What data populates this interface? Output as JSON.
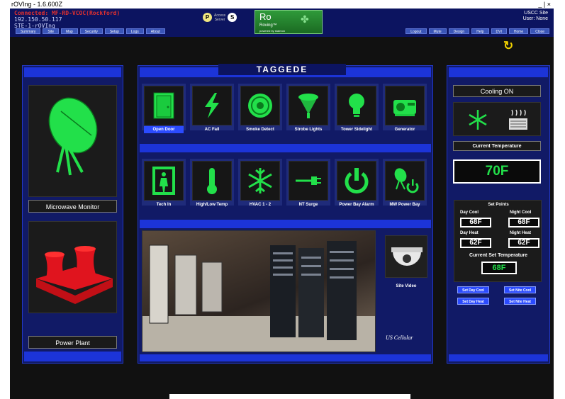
{
  "window": {
    "title": "rOVIng - 1.6.600Z",
    "controls": "_ | ×"
  },
  "connection": {
    "line1": "Connected: MF-RD-VCOC(Rockford)",
    "line2": "192.150.50.117",
    "line3": "STE-1-rOVIng"
  },
  "pserver": {
    "p": "P",
    "s": "S",
    "line1": "Access",
    "line2": "Server"
  },
  "logo": {
    "ro": "Ro",
    "roving": "Roving™",
    "powered": "powered by statmon"
  },
  "site_info": {
    "line1": "USCC Site",
    "line2": "User: None"
  },
  "nav_left": [
    "Summary",
    "Site",
    "Map",
    "Security",
    "Setup",
    "Logs",
    "About"
  ],
  "nav_right": [
    "Logout",
    "Mute",
    "Design",
    "Help",
    "DVI",
    "Home",
    "Close"
  ],
  "left": {
    "top_label": "Microwave Monitor",
    "bottom_label": "Power Plant"
  },
  "center": {
    "header": "TAGGEDE",
    "row1": [
      {
        "label": "Open Door",
        "icon": "door-icon",
        "active": true
      },
      {
        "label": "AC Fail",
        "icon": "lightning-icon",
        "active": false
      },
      {
        "label": "Smoke Detect",
        "icon": "smoke-detector-icon",
        "active": false
      },
      {
        "label": "Strobe Lights",
        "icon": "strobe-light-icon",
        "active": false
      },
      {
        "label": "Tower Sidelight",
        "icon": "bulb-icon",
        "active": false
      },
      {
        "label": "Generator",
        "icon": "generator-icon",
        "active": false
      }
    ],
    "row2": [
      {
        "label": "Tech In",
        "icon": "person-door-icon"
      },
      {
        "label": "High/Low Temp",
        "icon": "thermometer-icon"
      },
      {
        "label": "HVAC 1 - 2",
        "icon": "snowflake-icon"
      },
      {
        "label": "NT Surge",
        "icon": "plug-icon"
      },
      {
        "label": "Power Bay Alarm",
        "icon": "power-icon"
      },
      {
        "label": "MW Power Bay",
        "icon": "dish-power-icon"
      }
    ],
    "site_video": "Site Video",
    "brand": "US Cellular"
  },
  "right": {
    "status": "Cooling ON",
    "current_temp_label": "Current Temperature",
    "current_temp": "70F",
    "set_points_title": "Set Points",
    "day_cool_label": "Day Cool",
    "day_cool": "68F",
    "night_cool_label": "Night Cool",
    "night_cool": "68F",
    "day_heat_label": "Day Heat",
    "day_heat": "62F",
    "night_heat_label": "Night Heat",
    "night_heat": "62F",
    "current_set_label": "Current Set Temperature",
    "current_set": "68F",
    "buttons": {
      "day_cool": "Set Day Cool",
      "nite_cool": "Set Nite Cool",
      "day_heat": "Set Day Heat",
      "nite_heat": "Set Nite Heat"
    }
  },
  "colors": {
    "accent_green": "#22e04a",
    "panel_blue": "#1c34d8",
    "active_blue": "#2b4bff",
    "dish_red": "#e0141e",
    "connected_red": "#e0302f"
  }
}
